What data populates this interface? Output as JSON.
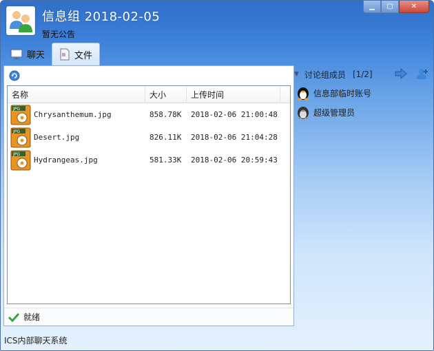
{
  "window": {
    "title": "信息组  2018-02-05",
    "notice": "暂无公告"
  },
  "tabs": [
    {
      "label": "聊天",
      "icon": "chat-monitor-icon",
      "active": false
    },
    {
      "label": "文件",
      "icon": "file-document-icon",
      "active": true
    }
  ],
  "files": {
    "columns": {
      "name": "名称",
      "size": "大小",
      "time": "上传时间"
    },
    "rows": [
      {
        "name": "Chrysanthemum.jpg",
        "size": "858.78K",
        "time": "2018-02-06 21:00:48",
        "icon_label": "JPG"
      },
      {
        "name": "Desert.jpg",
        "size": "826.11K",
        "time": "2018-02-06 21:04:28",
        "icon_label": "JPG"
      },
      {
        "name": "Hydrangeas.jpg",
        "size": "581.33K",
        "time": "2018-02-06 20:59:43",
        "icon_label": "JPG"
      }
    ]
  },
  "status": {
    "text": "就绪"
  },
  "members": {
    "title": "讨论组成员",
    "count": "[1/2]",
    "list": [
      {
        "name": "信息部临时账号",
        "online": true
      },
      {
        "name": "超级管理员",
        "online": false
      }
    ]
  },
  "footer": {
    "app_name": "ICS内部聊天系统"
  },
  "colors": {
    "title_bar": "#2f6fc9",
    "accent": "#3e82da",
    "status_ok": "#3aa53a",
    "jpg_orange": "#e99323"
  }
}
